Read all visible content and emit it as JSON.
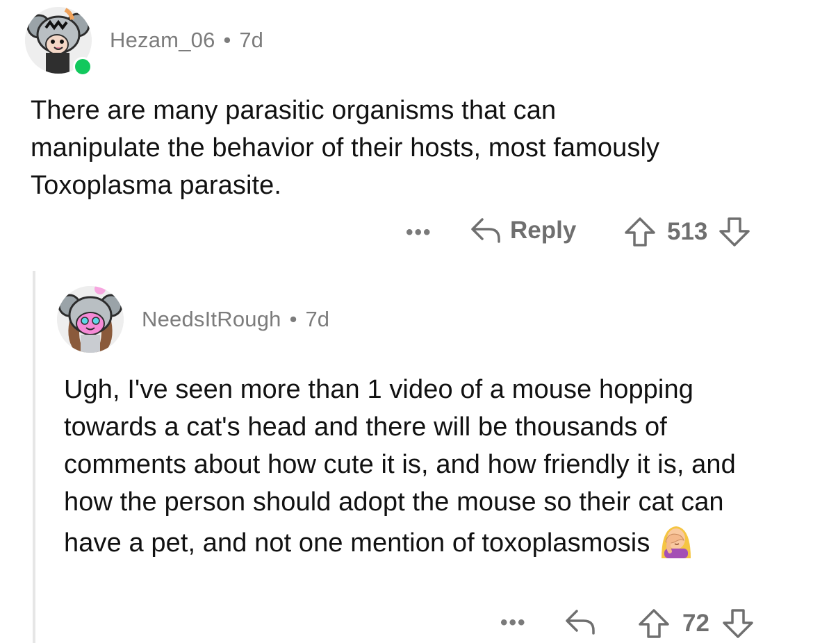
{
  "comments": [
    {
      "username": "Hezam_06",
      "separator": "•",
      "age": "7d",
      "body": "There are many parasitic organisms that can manipulate the behavior of their hosts, most famously Toxoplasma parasite.",
      "actions": {
        "more": "•••",
        "reply_label": "Reply",
        "votes": "513"
      },
      "online": true
    },
    {
      "username": "NeedsItRough",
      "separator": "•",
      "age": "7d",
      "body": "Ugh, I've seen more than 1 video of a mouse hopping towards a cat's head and there will be thousands of comments about how cute it is, and how friendly it is, and how the person should adopt the mouse so their cat can have a pet, and not one mention of toxoplasmosis",
      "emoji": "woman-facepalming",
      "actions": {
        "more": "•••",
        "votes": "72"
      }
    }
  ],
  "colors": {
    "meta": "#7c7c7c",
    "online": "#12c85d",
    "thread_line": "#e6e6e6"
  },
  "icons": [
    "reply-arrow-icon",
    "upvote-arrow-icon",
    "downvote-arrow-icon",
    "facepalm-emoji",
    "avatar-koala"
  ]
}
